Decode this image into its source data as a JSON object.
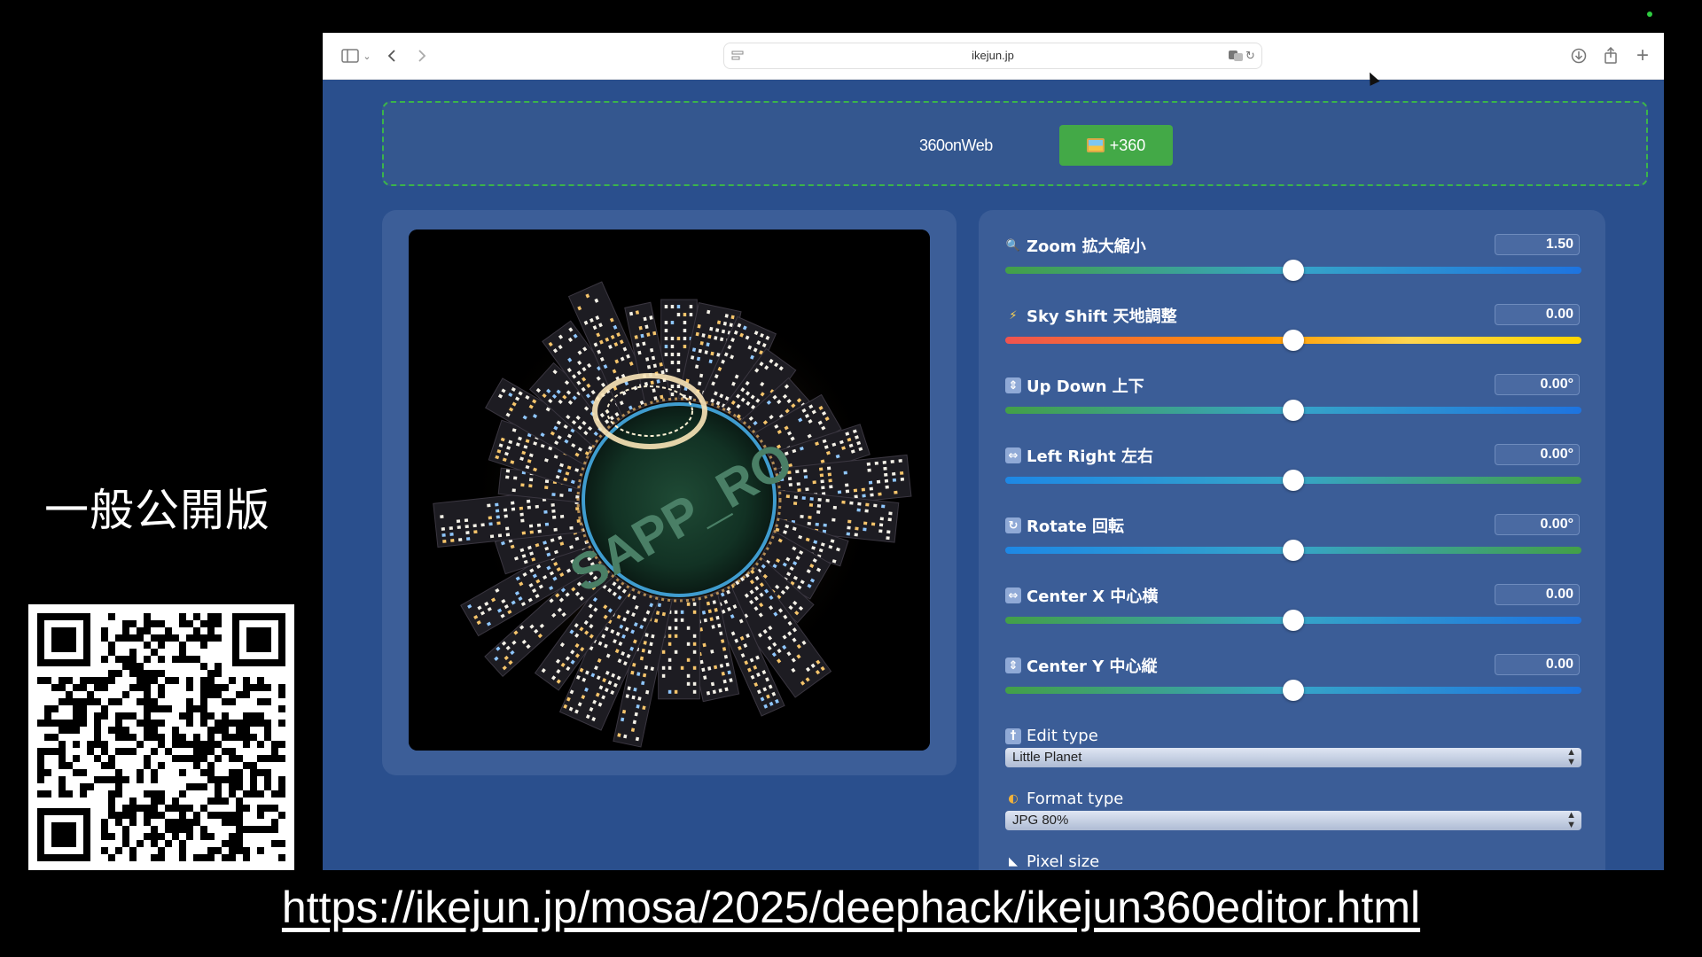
{
  "slide": {
    "side_title": "一般公開版",
    "url_caption": "https://ikejun.jp/mosa/2025/deephack/ikejun360editor.html"
  },
  "browser": {
    "address": "ikejun.jp",
    "icons": [
      "sidebar-icon",
      "chevron-down-icon",
      "back-icon",
      "forward-icon",
      "site-settings-icon",
      "translate-icon",
      "reload-icon",
      "download-icon",
      "share-icon",
      "new-tab-icon",
      "tabs-overview-icon"
    ]
  },
  "banner": {
    "label": "360onWeb",
    "button_label": "+360",
    "button_color": "#43a947"
  },
  "viewer": {
    "image_text": "SAPP_RO"
  },
  "controls": [
    {
      "icon": "magnifier-icon",
      "label": "Zoom 拡大縮小",
      "value": "1.50",
      "level": 0.5
    },
    {
      "icon": "lightning-icon",
      "label": "Sky Shift 天地調整",
      "value": "0.00",
      "level": 0.5
    },
    {
      "icon": "up-down-arrow-icon",
      "label": "Up Down 上下",
      "value": "0.00°",
      "level": 0.5
    },
    {
      "icon": "left-right-arrow-icon",
      "label": "Left Right 左右",
      "value": "0.00°",
      "level": 0.5
    },
    {
      "icon": "rotate-icon",
      "label": "Rotate 回転",
      "value": "0.00°",
      "level": 0.5
    },
    {
      "icon": "left-right-arrow-icon",
      "label": "Center X 中心横",
      "value": "0.00",
      "level": 0.5
    },
    {
      "icon": "up-down-arrow-icon",
      "label": "Center Y 中心縦",
      "value": "0.00",
      "level": 0.5
    }
  ],
  "selects": [
    {
      "icon": "dagger-icon",
      "label": "Edit type",
      "value": "Little Planet"
    },
    {
      "icon": "palette-icon",
      "label": "Format type",
      "value": "JPG 80%"
    },
    {
      "icon": "ruler-icon",
      "label": "Pixel size"
    }
  ],
  "colors": {
    "page_bg": "#2a4f8d",
    "panel_bg": "#3b5d97",
    "banner_border": "#3bb44a"
  }
}
